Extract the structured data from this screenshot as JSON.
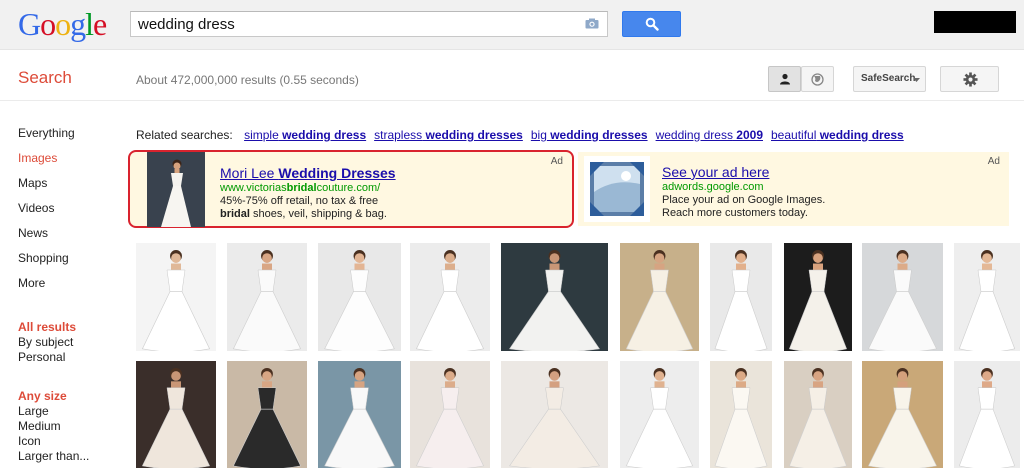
{
  "header": {
    "logo_letters": [
      {
        "ch": "G",
        "color": "#3369e8"
      },
      {
        "ch": "o",
        "color": "#d50f25"
      },
      {
        "ch": "o",
        "color": "#eeb211"
      },
      {
        "ch": "g",
        "color": "#3369e8"
      },
      {
        "ch": "l",
        "color": "#009925"
      },
      {
        "ch": "e",
        "color": "#d50f25"
      }
    ],
    "search_query": "wedding dress"
  },
  "toolbar": {
    "search_label": "Search",
    "result_stats": "About 472,000,000 results (0.55 seconds)",
    "safesearch_label": "SafeSearch"
  },
  "leftnav": {
    "items": [
      {
        "label": "Everything",
        "active": false
      },
      {
        "label": "Images",
        "active": true
      },
      {
        "label": "Maps",
        "active": false
      },
      {
        "label": "Videos",
        "active": false
      },
      {
        "label": "News",
        "active": false
      },
      {
        "label": "Shopping",
        "active": false
      },
      {
        "label": "More",
        "active": false
      }
    ],
    "results_heading": "All results",
    "results_options": [
      "By subject",
      "Personal"
    ],
    "size_heading": "Any size",
    "size_options": [
      "Large",
      "Medium",
      "Icon",
      "Larger than..."
    ]
  },
  "related": {
    "label": "Related searches:",
    "links": [
      {
        "prefix": "simple",
        "bold": " wedding dress",
        "suffix": ""
      },
      {
        "prefix": "strapless",
        "bold": " wedding dresses",
        "suffix": ""
      },
      {
        "prefix": "big",
        "bold": " wedding dresses",
        "suffix": ""
      },
      {
        "prefix": "wedding dress",
        "bold": " 2009",
        "suffix": ""
      },
      {
        "prefix": "beautiful",
        "bold": " wedding dress",
        "suffix": ""
      }
    ]
  },
  "ads": {
    "left": {
      "label": "Ad",
      "title_plain": "Mori Lee ",
      "title_bold": "Wedding Dresses",
      "url_a": "www.victorias",
      "url_b": "bridal",
      "url_c": "couture.com/",
      "line1": "45%-75% off retail, no tax & free",
      "line2_bold": "bridal",
      "line2_rest": " shoes, veil, shipping & bag."
    },
    "right": {
      "label": "Ad",
      "title": "See your ad here",
      "url": "adwords.google.com",
      "line1": "Place your ad on Google Images.",
      "line2": "Reach more customers today."
    }
  },
  "image_grid": {
    "rows": [
      [
        {
          "bg": "#f4f4f4",
          "dress": "#ffffff",
          "skin": "#e0b898"
        },
        {
          "bg": "#ebebeb",
          "dress": "#fafafa",
          "skin": "#d9a684"
        },
        {
          "bg": "#e8e8e8",
          "dress": "#fdfdfd",
          "skin": "#e3b594"
        },
        {
          "bg": "#ececec",
          "dress": "#ffffff",
          "skin": "#dcae8c"
        },
        {
          "bg": "#2e3a40",
          "dress": "#f2f2f0",
          "skin": "#c89676"
        },
        {
          "bg": "#c7b08a",
          "dress": "#f6f0e4",
          "skin": "#d6a482"
        },
        {
          "bg": "#e9e9e9",
          "dress": "#ffffff",
          "skin": "#e2b08c"
        },
        {
          "bg": "#1c1c1c",
          "dress": "#f4f1ea",
          "skin": "#d8a27e"
        },
        {
          "bg": "#d6d8da",
          "dress": "#fafafa",
          "skin": "#dcab88"
        },
        {
          "bg": "#eeeeee",
          "dress": "#ffffff",
          "skin": "#e4b896"
        }
      ],
      [
        {
          "bg": "#3a2e2a",
          "dress": "#efe6dc",
          "skin": "#c99676"
        },
        {
          "bg": "#c9b9a6",
          "dress": "#2a2a2a",
          "skin": "#d8a684"
        },
        {
          "bg": "#7a96a6",
          "dress": "#f8f8f8",
          "skin": "#d6a482"
        },
        {
          "bg": "#e8e2dc",
          "dress": "#f6eeee",
          "skin": "#dcac8a"
        },
        {
          "bg": "#ece8e4",
          "dress": "#f3ece4",
          "skin": "#d4a080"
        },
        {
          "bg": "#ededed",
          "dress": "#ffffff",
          "skin": "#e0b290"
        },
        {
          "bg": "#eae4da",
          "dress": "#fbf8f2",
          "skin": "#dcaa86"
        },
        {
          "bg": "#d9cfc2",
          "dress": "#f5efe6",
          "skin": "#d8a482"
        },
        {
          "bg": "#c9a878",
          "dress": "#f8f4ea",
          "skin": "#d4a07c"
        },
        {
          "bg": "#ececec",
          "dress": "#ffffff",
          "skin": "#dea988"
        }
      ]
    ]
  }
}
